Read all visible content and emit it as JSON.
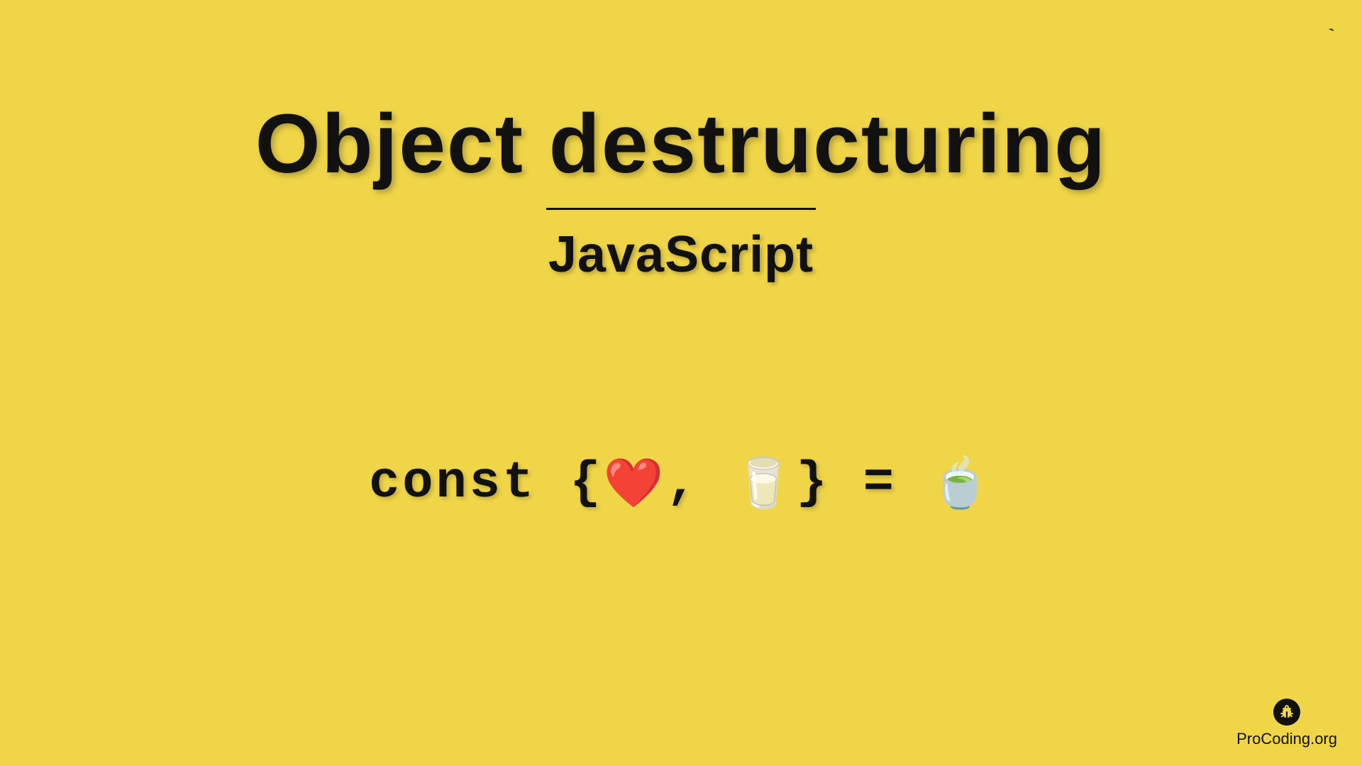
{
  "title": "Object destructuring",
  "subtitle": "JavaScript",
  "code": {
    "const": "const",
    "open_brace": "{",
    "heart_emoji": "❤️",
    "comma": ",",
    "glass_emoji": "🥛",
    "close_brace": "}",
    "equals": "=",
    "bowl_emoji": "🍵"
  },
  "branding": {
    "text": "ProCoding.org",
    "icon_name": "bug-icon"
  },
  "corner": "`"
}
